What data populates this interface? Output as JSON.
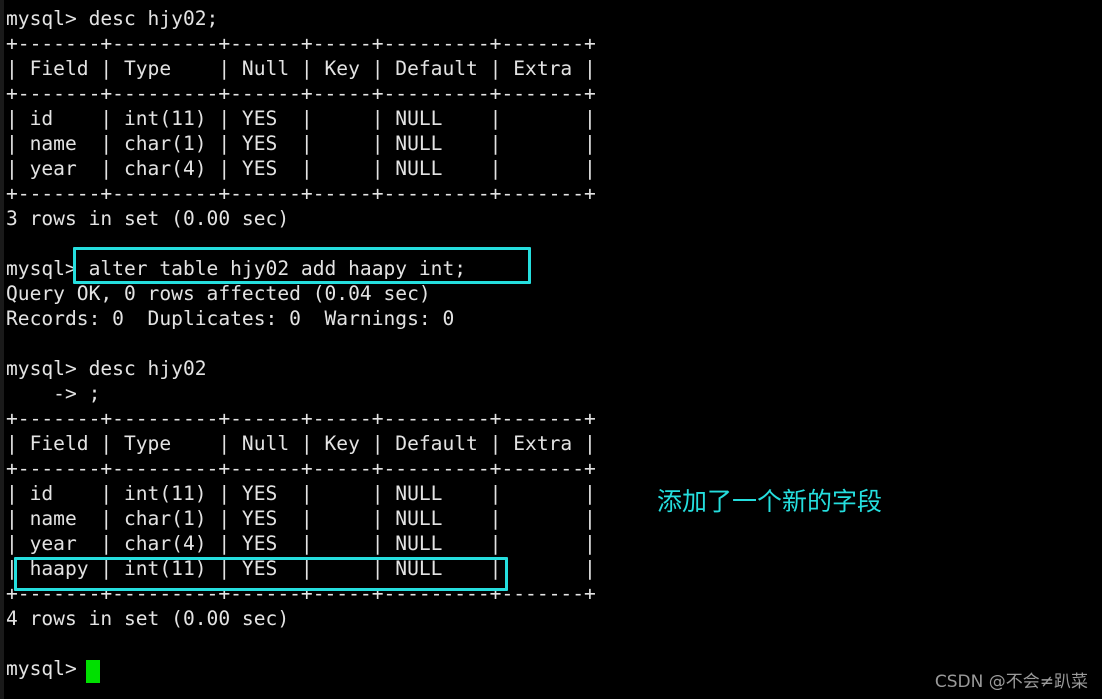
{
  "terminal": {
    "prompt": "mysql>",
    "lines": [
      "mysql> desc hjy02;",
      "+-------+---------+------+-----+---------+-------+",
      "| Field | Type    | Null | Key | Default | Extra |",
      "+-------+---------+------+-----+---------+-------+",
      "| id    | int(11) | YES  |     | NULL    |       |",
      "| name  | char(1) | YES  |     | NULL    |       |",
      "| year  | char(4) | YES  |     | NULL    |       |",
      "+-------+---------+------+-----+---------+-------+",
      "3 rows in set (0.00 sec)",
      "",
      "mysql> alter table hjy02 add haapy int;",
      "Query OK, 0 rows affected (0.04 sec)",
      "Records: 0  Duplicates: 0  Warnings: 0",
      "",
      "mysql> desc hjy02",
      "    -> ;",
      "+-------+---------+------+-----+---------+-------+",
      "| Field | Type    | Null | Key | Default | Extra |",
      "+-------+---------+------+-----+---------+-------+",
      "| id    | int(11) | YES  |     | NULL    |       |",
      "| name  | char(1) | YES  |     | NULL    |       |",
      "| year  | char(4) | YES  |     | NULL    |       |",
      "| haapy | int(11) | YES  |     | NULL    |       |",
      "+-------+---------+------+-----+---------+-------+",
      "4 rows in set (0.00 sec)",
      "",
      "mysql> "
    ],
    "first_result": {
      "headers": [
        "Field",
        "Type",
        "Null",
        "Key",
        "Default",
        "Extra"
      ],
      "rows": [
        [
          "id",
          "int(11)",
          "YES",
          "",
          "NULL",
          ""
        ],
        [
          "name",
          "char(1)",
          "YES",
          "",
          "NULL",
          ""
        ],
        [
          "year",
          "char(4)",
          "YES",
          "",
          "NULL",
          ""
        ]
      ],
      "footer": "3 rows in set (0.00 sec)"
    },
    "alter_command": "alter table hjy02 add haapy int;",
    "alter_result": {
      "query_ok": "Query OK, 0 rows affected (0.04 sec)",
      "records": "Records: 0  Duplicates: 0  Warnings: 0"
    },
    "second_command": "desc hjy02",
    "second_continuation": "    -> ;",
    "second_result": {
      "headers": [
        "Field",
        "Type",
        "Null",
        "Key",
        "Default",
        "Extra"
      ],
      "rows": [
        [
          "id",
          "int(11)",
          "YES",
          "",
          "NULL",
          ""
        ],
        [
          "name",
          "char(1)",
          "YES",
          "",
          "NULL",
          ""
        ],
        [
          "year",
          "char(4)",
          "YES",
          "",
          "NULL",
          ""
        ],
        [
          "haapy",
          "int(11)",
          "YES",
          "",
          "NULL",
          ""
        ]
      ],
      "footer": "4 rows in set (0.00 sec)"
    }
  },
  "annotations": {
    "note_text": "添加了一个新的字段",
    "highlight_color": "#25dede",
    "cursor_color": "#00e000",
    "text_color": "#e3e3e3",
    "background_color": "#000000"
  },
  "watermark": {
    "text": "CSDN @不会≠趴菜"
  }
}
